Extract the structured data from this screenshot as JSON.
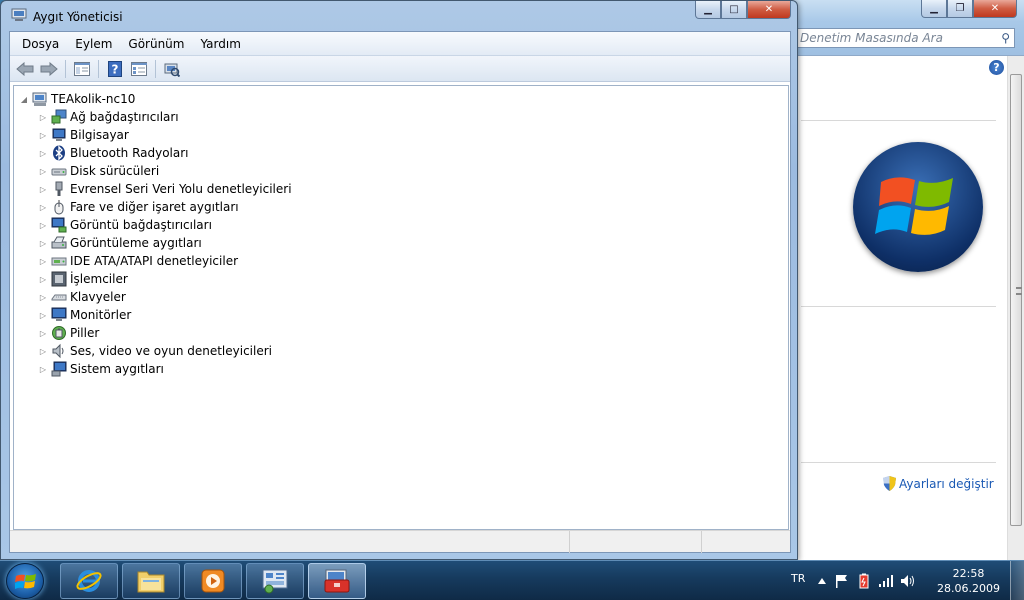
{
  "background_window": {
    "search_placeholder": "Denetim Masasında Ara",
    "change_settings_link": "Ayarları değiştir"
  },
  "window": {
    "title": "Aygıt Yöneticisi",
    "menu": [
      "Dosya",
      "Eylem",
      "Görünüm",
      "Yardım"
    ],
    "toolbar_icons": [
      "back-arrow-icon",
      "forward-arrow-icon",
      "show-hide-console-tree-icon",
      "help-icon",
      "properties-icon",
      "scan-hardware-icon"
    ],
    "tree": {
      "root": "TEAkolik-nc10",
      "children": [
        "Ağ bağdaştırıcıları",
        "Bilgisayar",
        "Bluetooth Radyoları",
        "Disk sürücüleri",
        "Evrensel Seri Veri Yolu denetleyicileri",
        "Fare ve diğer işaret aygıtları",
        "Görüntü bağdaştırıcıları",
        "Görüntüleme aygıtları",
        "IDE ATA/ATAPI denetleyiciler",
        "İşlemciler",
        "Klavyeler",
        "Monitörler",
        "Piller",
        "Ses, video ve oyun denetleyicileri",
        "Sistem aygıtları"
      ]
    }
  },
  "taskbar": {
    "apps": [
      "internet-explorer",
      "windows-explorer",
      "media-player",
      "control-panel",
      "device-manager"
    ],
    "language": "TR",
    "time": "22:58",
    "date": "28.06.2009"
  }
}
